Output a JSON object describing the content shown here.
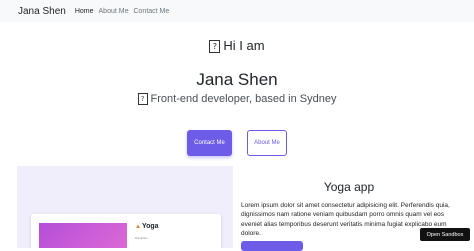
{
  "navbar": {
    "brand": "Jana Shen",
    "links": [
      {
        "label": "Home"
      },
      {
        "label": "About Me"
      },
      {
        "label": "Contact Me"
      }
    ]
  },
  "hero": {
    "missing_glyph": "?",
    "greeting": "Hi I am",
    "name": "Jana Shen",
    "tagline": "Front-end developer, based in Sydney",
    "contact_button": "Contact Me",
    "about_button": "About Me"
  },
  "project": {
    "preview_title": "Yoga",
    "preview_icon": "flame-icon",
    "preview_caption": "Discipline",
    "title": "Yoga app",
    "description": "Lorem ipsum dolor sit amet consectetur adipisicing elit. Perferendis quia, dignissimos nam ratione veniam quibusdam porro omnis quam vel eos eveniet alias temporibus deserunt veritatis minima fugiat explicabo eum dolore."
  },
  "sandbox": {
    "label": "Open Sandbox"
  },
  "colors": {
    "accent": "#6c5ce7",
    "navbar_bg": "#f8f9fa",
    "preview_bg": "#f1eefb"
  }
}
